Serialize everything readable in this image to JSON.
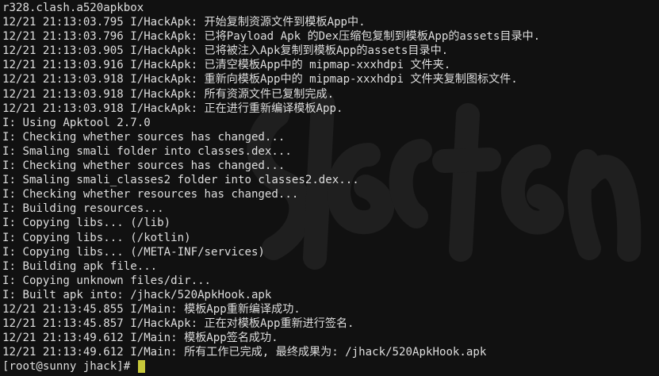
{
  "terminal": {
    "lines": [
      "r328.clash.a520apkbox",
      "12/21 21:13:03.795 I/HackApk: 开始复制资源文件到模板App中.",
      "12/21 21:13:03.796 I/HackApk: 已将Payload Apk 的Dex压缩包复制到模板App的assets目录中.",
      "12/21 21:13:03.905 I/HackApk: 已将被注入Apk复制到模板App的assets目录中.",
      "12/21 21:13:03.916 I/HackApk: 已清空模板App中的 mipmap-xxxhdpi 文件夹.",
      "12/21 21:13:03.918 I/HackApk: 重新向模板App中的 mipmap-xxxhdpi 文件夹复制图标文件.",
      "12/21 21:13:03.918 I/HackApk: 所有资源文件已复制完成.",
      "12/21 21:13:03.918 I/HackApk: 正在进行重新编译模板App.",
      "I: Using Apktool 2.7.0",
      "I: Checking whether sources has changed...",
      "I: Smaling smali folder into classes.dex...",
      "I: Checking whether sources has changed...",
      "I: Smaling smali_classes2 folder into classes2.dex...",
      "I: Checking whether resources has changed...",
      "I: Building resources...",
      "I: Copying libs... (/lib)",
      "I: Copying libs... (/kotlin)",
      "I: Copying libs... (/META-INF/services)",
      "I: Building apk file...",
      "I: Copying unknown files/dir...",
      "I: Built apk into: /jhack/520ApkHook.apk",
      "12/21 21:13:45.855 I/Main: 模板App重新编译成功.",
      "12/21 21:13:45.857 I/HackApk: 正在对模板App重新进行签名.",
      "12/21 21:13:49.612 I/Main: 模板App签名成功.",
      "12/21 21:13:49.612 I/Main: 所有工作已完成, 最终成果为: /jhack/520ApkHook.apk"
    ],
    "prompt": "[root@sunny jhack]# "
  },
  "colors": {
    "background": "#111111",
    "text": "#dedede",
    "cursor": "#c7c83a"
  },
  "icons": {
    "cursor": "block-cursor"
  }
}
